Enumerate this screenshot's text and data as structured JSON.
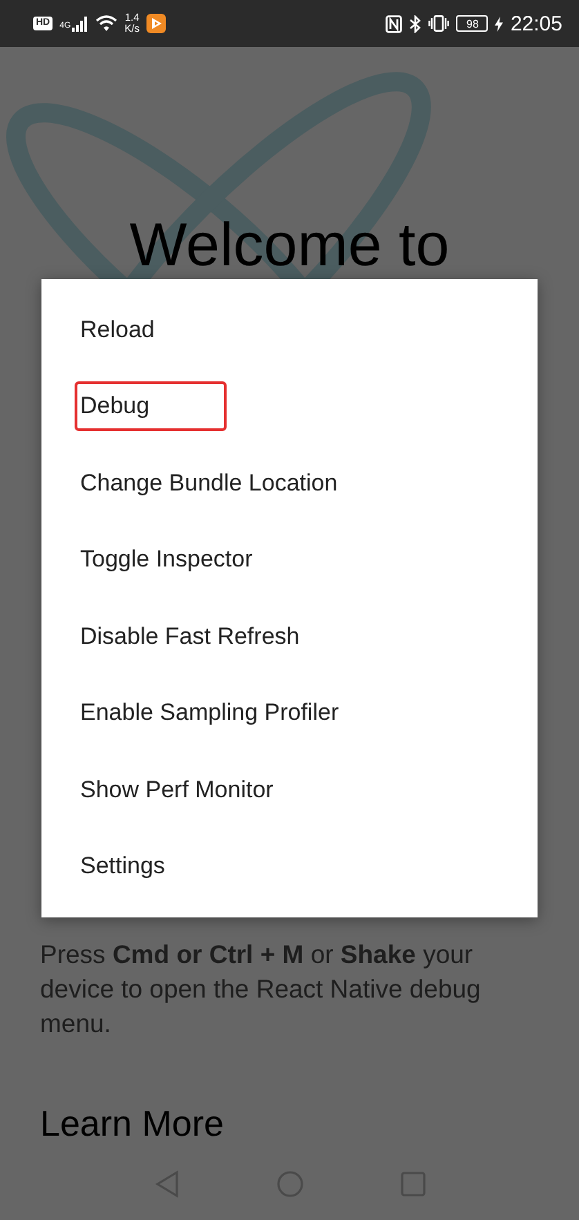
{
  "status_bar": {
    "hd_badge": "HD",
    "network_type": "4G",
    "speed_value": "1.4",
    "speed_unit": "K/s",
    "battery": "98",
    "charging": true,
    "time": "22:05"
  },
  "page": {
    "title": "Welcome to",
    "instructions": "Press **Cmd or Ctrl + M** or **Shake** your device to open the React Native debug menu.",
    "section_heading": "Learn More"
  },
  "dev_menu": {
    "items": [
      {
        "label": "Reload",
        "highlighted": false
      },
      {
        "label": "Debug",
        "highlighted": true
      },
      {
        "label": "Change Bundle Location",
        "highlighted": false
      },
      {
        "label": "Toggle Inspector",
        "highlighted": false
      },
      {
        "label": "Disable Fast Refresh",
        "highlighted": false
      },
      {
        "label": "Enable Sampling Profiler",
        "highlighted": false
      },
      {
        "label": "Show Perf Monitor",
        "highlighted": false
      },
      {
        "label": "Settings",
        "highlighted": false
      }
    ]
  }
}
